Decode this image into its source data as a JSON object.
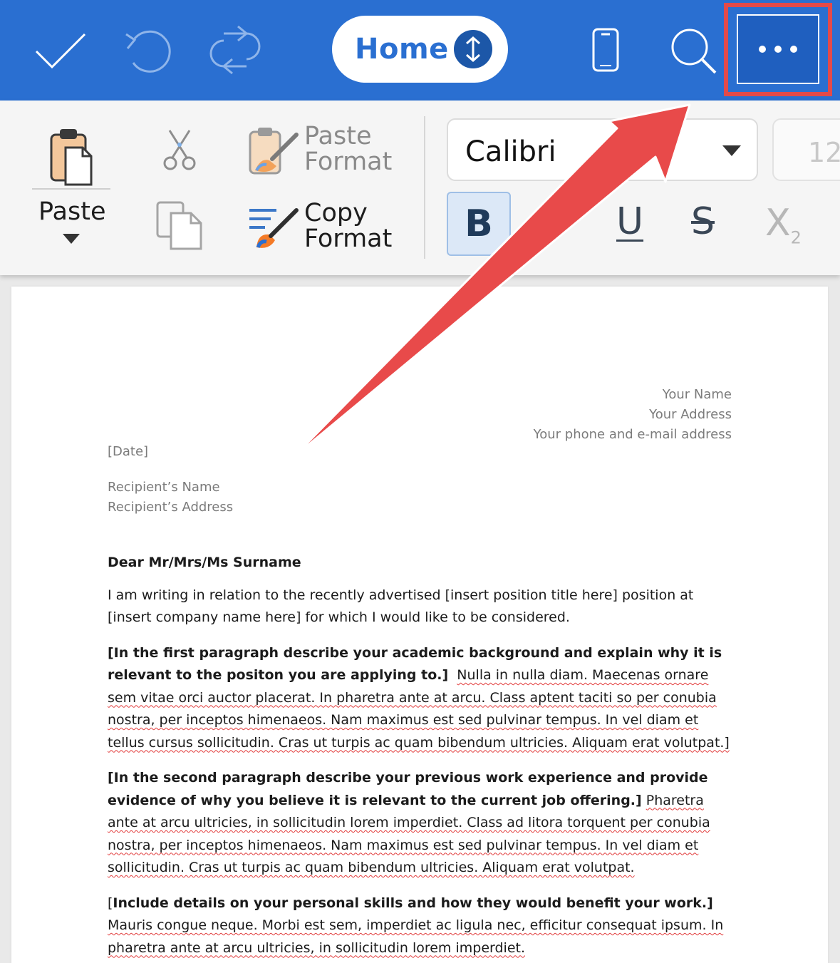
{
  "topbar": {
    "home_label": "Home",
    "icons": {
      "done": "checkmark-icon",
      "undo": "undo-icon",
      "redo": "redo-icon",
      "swap": "up-down-arrows-icon",
      "device": "phone-icon",
      "search": "search-icon",
      "more": "more-dots-icon"
    },
    "colors": {
      "bar": "#2a6fd1",
      "highlight": "#e34a4a"
    }
  },
  "ribbon": {
    "paste_label": "Paste",
    "paste_format_line1": "Paste",
    "paste_format_line2": "Format",
    "copy_format_line1": "Copy",
    "copy_format_line2": "Format",
    "font_name": "Calibri",
    "font_size": "12",
    "bold_glyph": "B",
    "underline_glyph": "U",
    "strike_glyph": "S",
    "subscript_glyph": "X",
    "subscript_small": "2"
  },
  "document": {
    "sender_name": "Your Name",
    "sender_address": "Your Address",
    "sender_contact": "Your phone and e-mail address",
    "date": "[Date]",
    "recipient_name": "Recipient’s Name",
    "recipient_address": "Recipient’s Address",
    "salutation": "Dear Mr/Mrs/Ms Surname",
    "intro": "I am writing in relation to the recently advertised [insert position title here] position at [insert company name here] for which I would like to be considered.",
    "p1_bold": "[In the first paragraph describe your academic background and explain why it is relevant to the positon you are applying to.]",
    "p1_text": "Nulla in nulla diam. Maecenas ornare sem vitae orci auctor placerat. In pharetra ante at arcu. Class aptent taciti so per conubia nostra, per inceptos himenaeos. Nam maximus est sed pulvinar tempus. In vel diam et tellus cursus sollicitudin. Cras ut turpis ac quam bibendum ultricies. Aliquam erat volutpat.]",
    "p2_bold": "[In the second paragraph describe your previous work experience and provide evidence of why you believe it is relevant to the current job offering.]",
    "p2_text": "Pharetra ante at arcu ultricies, in sollicitudin lorem imperdiet. Class ad litora torquent per conubia nostra, per inceptos himenaeos. Nam maximus est sed pulvinar tempus. In vel diam et sollicitudin. Cras ut turpis ac quam bibendum ultricies. Aliquam erat volutpat.",
    "p3_open": "[",
    "p3_bold": "Include details on your personal skills and how they would benefit your work.]",
    "p3_text": "Mauris congue neque. Morbi est sem, imperdiet ac ligula nec, efficitur consequat ipsum. In pharetra ante at arcu ultricies, in sollicitudin lorem imperdiet."
  }
}
